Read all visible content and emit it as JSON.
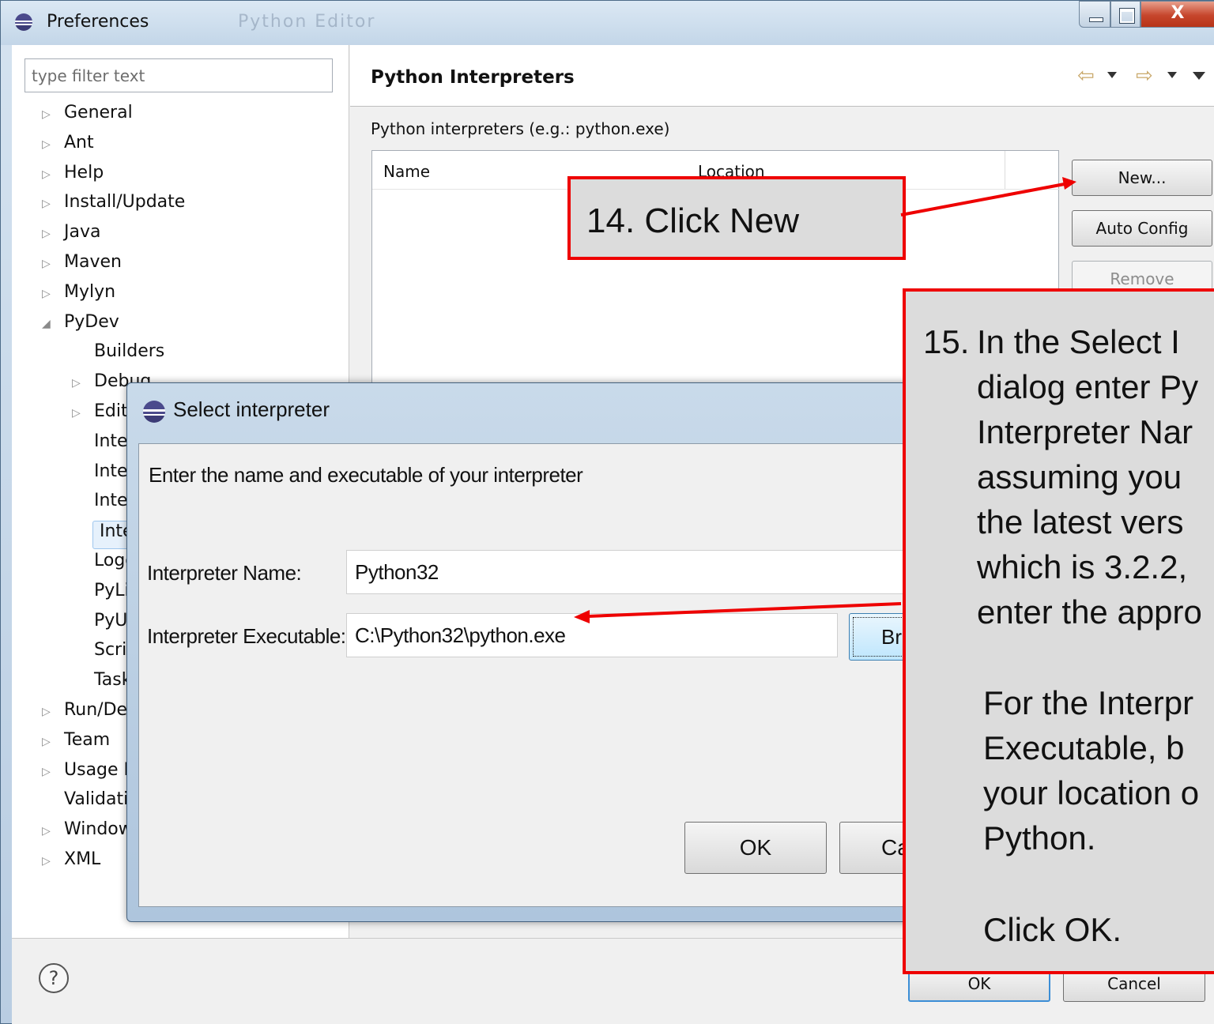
{
  "window": {
    "title": "Preferences",
    "faint_title": "Python Editor",
    "close_glyph": "X"
  },
  "filter": {
    "placeholder": "type filter text"
  },
  "tree": [
    {
      "label": "General",
      "arrow": "▷"
    },
    {
      "label": "Ant",
      "arrow": "▷"
    },
    {
      "label": "Help",
      "arrow": "▷"
    },
    {
      "label": "Install/Update",
      "arrow": "▷"
    },
    {
      "label": "Java",
      "arrow": "▷"
    },
    {
      "label": "Maven",
      "arrow": "▷"
    },
    {
      "label": "Mylyn",
      "arrow": "▷"
    },
    {
      "label": "PyDev",
      "arrow": "◢"
    },
    {
      "label": "Builders",
      "arrow": ""
    },
    {
      "label": "Debug",
      "arrow": "▷"
    },
    {
      "label": "Editor",
      "arrow": "▷"
    },
    {
      "label": "Inte",
      "arrow": ""
    },
    {
      "label": "Inte",
      "arrow": ""
    },
    {
      "label": "Inte",
      "arrow": ""
    },
    {
      "label": "Inte",
      "arrow": ""
    },
    {
      "label": "Logg",
      "arrow": ""
    },
    {
      "label": "PyLi",
      "arrow": ""
    },
    {
      "label": "PyU",
      "arrow": ""
    },
    {
      "label": "Scrip",
      "arrow": ""
    },
    {
      "label": "Task",
      "arrow": ""
    },
    {
      "label": "Run/De",
      "arrow": "▷"
    },
    {
      "label": "Team",
      "arrow": "▷"
    },
    {
      "label": "Usage D",
      "arrow": "▷"
    },
    {
      "label": "Validati",
      "arrow": ""
    },
    {
      "label": "Window",
      "arrow": "▷"
    },
    {
      "label": "XML",
      "arrow": "▷"
    }
  ],
  "page": {
    "title": "Python Interpreters",
    "interpreters_label": "Python interpreters (e.g.: python.exe)",
    "columns": {
      "name": "Name",
      "location": "Location"
    },
    "buttons": {
      "new": "New...",
      "auto_config": "Auto Config",
      "remove": "Remove"
    },
    "nav": {
      "back_icon": "⇦",
      "forward_icon": "⇨"
    }
  },
  "footer": {
    "help_glyph": "?",
    "ok": "OK",
    "cancel": "Cancel"
  },
  "dialog": {
    "title": "Select interpreter",
    "message": "Enter the name and executable of your interpreter",
    "name_label": "Interpreter Name:",
    "name_value": "Python32",
    "exe_label": "Interpreter Executable:",
    "exe_value": "C:\\Python32\\python.exe",
    "browse": "Br",
    "ok": "OK",
    "cancel": "Ca"
  },
  "callouts": {
    "step14": "14.  Click New",
    "step15_num": "15.",
    "step15_lines": [
      "In the Select I",
      "dialog enter Py",
      "Interpreter Nar",
      "assuming you",
      "the latest vers",
      "which is 3.2.2,",
      "enter the appro",
      "For the Interpr",
      "Executable, b",
      "your location o",
      "Python.",
      "Click OK."
    ]
  },
  "colors": {
    "callout_border": "#ee0000",
    "callout_bg": "#dcdcdc",
    "arrow": "#ee0000"
  }
}
